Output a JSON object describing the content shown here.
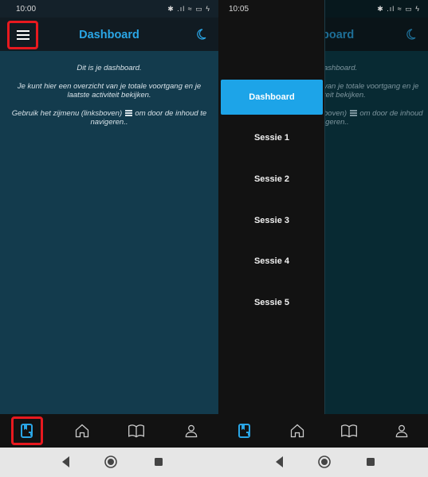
{
  "left": {
    "status": {
      "time": "10:00",
      "icons": "✱ .ıl ≈ ▭ ϟ"
    },
    "appbar": {
      "title": "Dashboard"
    },
    "content": {
      "line1": "Dit is je dashboard.",
      "line2": "Je kunt hier een overzicht van je totale voortgang en je laatste activiteit bekijken.",
      "line3a": "Gebruik het zijmenu (linksboven)",
      "line3b": "om door de inhoud te navigeren.."
    }
  },
  "right": {
    "status": {
      "time": "10:05",
      "icons": "✱ .ıl ≈ ▭ ϟ"
    },
    "bg": {
      "title": "board",
      "line1": "ashboard.",
      "line2a": "van je totale voortgang en je",
      "line2b": "teit bekijken.",
      "line3a": "boven)",
      "line3b": "om door de inhoud",
      "line3c": "igeren.."
    },
    "drawer": {
      "items": [
        {
          "label": "Dashboard",
          "active": true
        },
        {
          "label": "Sessie 1"
        },
        {
          "label": "Sessie 2"
        },
        {
          "label": "Sessie 3"
        },
        {
          "label": "Sessie 4"
        },
        {
          "label": "Sessie 5"
        }
      ]
    }
  },
  "nav_icons": [
    "bookmark-note-icon",
    "home-icon",
    "book-icon",
    "profile-icon"
  ],
  "system_nav": [
    "back-icon",
    "home-circle-icon",
    "recents-icon"
  ],
  "colors": {
    "accent": "#1da4e8",
    "highlight_border": "#e7191f",
    "content_bg": "#133b4d",
    "appbar_bg": "#111b22"
  }
}
